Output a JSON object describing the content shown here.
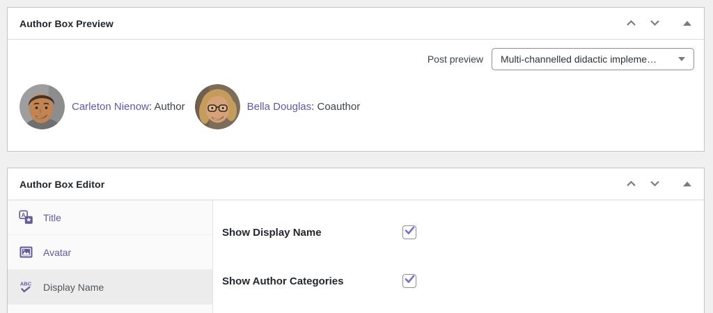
{
  "colors": {
    "page_bg": "#f0f0f1",
    "box_border": "#c3c4c7",
    "accent_purple": "#655997",
    "link_purple": "#6356a8",
    "checkmark_purple": "#7570cc",
    "control_gray": "#787c82",
    "header_text": "#1d2327",
    "active_item_bg": "#ececec"
  },
  "preview_box": {
    "title": "Author Box Preview",
    "controls": {
      "move_up_icon": "chevron-up",
      "move_down_icon": "chevron-down",
      "toggle_icon": "triangle-up"
    },
    "post_preview": {
      "label": "Post preview",
      "selected_option": "Multi-channelled didactic impleme…"
    },
    "authors": [
      {
        "name": "Carleton Nienow",
        "role": ": Author",
        "avatar": "man-photo-avatar"
      },
      {
        "name": "Bella Douglas",
        "role": ": Coauthor",
        "avatar": "woman-glasses-photo-avatar"
      }
    ]
  },
  "editor_box": {
    "title": "Author Box Editor",
    "controls": {
      "move_up_icon": "chevron-up",
      "move_down_icon": "chevron-down",
      "toggle_icon": "triangle-up"
    },
    "sidebar_items": [
      {
        "label": "Title",
        "icon": "translation-icon",
        "active": false
      },
      {
        "label": "Avatar",
        "icon": "image-icon",
        "active": false
      },
      {
        "label": "Display Name",
        "icon": "spellcheck-icon",
        "active": true
      }
    ],
    "fields": [
      {
        "label": "Show Display Name",
        "checked": true
      },
      {
        "label": "Show Author Categories",
        "checked": true
      }
    ]
  }
}
